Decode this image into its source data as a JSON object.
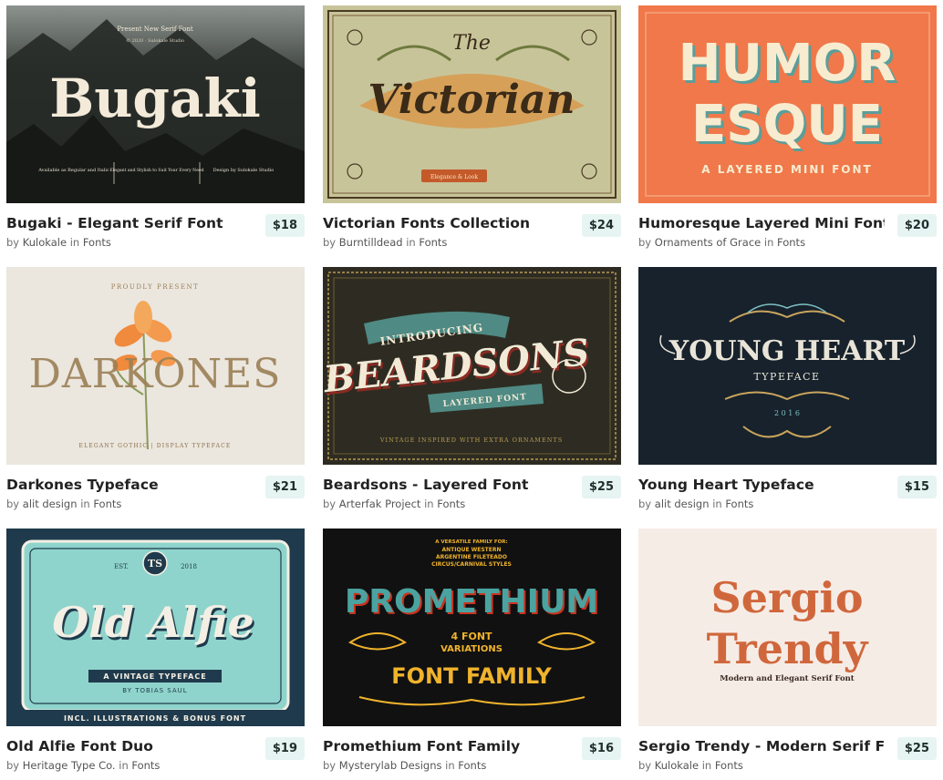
{
  "items": [
    {
      "title": "Bugaki - Elegant Serif Font",
      "price": "$18",
      "by": "by",
      "author": "Kulokale",
      "in": "in",
      "category": "Fonts",
      "thumb": {
        "headline": "Bugaki",
        "top_line": "Present New Serif Font",
        "sub_line": "© 2020 · Sulokale Studio",
        "foot_left": "Available as Regular and Italic",
        "foot_mid": "Elegant and Stylish to Suit Your Every Need",
        "foot_right": "Design by Sulokale Studio",
        "bg": "#2b2e2c",
        "fg": "#f3ead9"
      }
    },
    {
      "title": "Victorian Fonts Collection",
      "price": "$24",
      "by": "by",
      "author": "Burntilldead",
      "in": "in",
      "category": "Fonts",
      "thumb": {
        "headline": "Victorian",
        "top_line": "The",
        "badge": "Elegance & Look",
        "bg": "#c8c49a",
        "fg": "#3a2a18",
        "accent": "#c45a2a"
      }
    },
    {
      "title": "Humoresque Layered Mini Font",
      "price": "$20",
      "by": "by",
      "author": "Ornaments of Grace",
      "in": "in",
      "category": "Fonts",
      "thumb": {
        "line1": "HUMOR",
        "line2": "ESQUE",
        "sub": "A LAYERED MINI FONT",
        "bg": "#f0784a",
        "fg": "#f7ecd0",
        "shadow": "#5b9e9a"
      }
    },
    {
      "title": "Darkones Typeface",
      "price": "$21",
      "by": "by",
      "author": "alit design",
      "in": "in",
      "category": "Fonts",
      "thumb": {
        "headline": "DARKONES",
        "top_line": "PROUDLY PRESENT",
        "foot": "ELEGANT GOTHIC | DISPLAY TYPEFACE",
        "bg": "#ebe6de",
        "fg": "#9b8055",
        "flower": "#f08a3c"
      }
    },
    {
      "title": "Beardsons - Layered Font",
      "price": "$25",
      "by": "by",
      "author": "Arterfak Project",
      "in": "in",
      "category": "Fonts",
      "thumb": {
        "headline": "BEARDSONS",
        "top_line": "INTRODUCING",
        "sub": "LAYERED FONT",
        "foot": "VINTAGE INSPIRED WITH EXTRA ORNAMENTS",
        "bg": "#2e2c22",
        "fg": "#f2ead6",
        "accent": "#b89a52"
      }
    },
    {
      "title": "Young Heart Typeface",
      "price": "$15",
      "by": "by",
      "author": "alit design",
      "in": "in",
      "category": "Fonts",
      "thumb": {
        "headline": "YOUNG HEART",
        "sub": "TYPEFACE",
        "year": "2 0 1 6",
        "bg": "#17222c",
        "fg": "#e9e4d8",
        "accent": "#c9a45c"
      }
    },
    {
      "title": "Old Alfie Font Duo",
      "price": "$19",
      "by": "by",
      "author": "Heritage Type Co.",
      "in": "in",
      "category": "Fonts",
      "thumb": {
        "headline": "Old Alfie",
        "ribbon": "A VINTAGE TYPEFACE",
        "byline": "BY TOBIAS SAUL",
        "foot": "INCL. ILLUSTRATIONS & BONUS FONT",
        "est": "EST.",
        "year": "2018",
        "bg": "#1f3a4c",
        "panel": "#8fd4cc",
        "fg": "#f4efe4"
      }
    },
    {
      "title": "Promethium Font Family",
      "price": "$16",
      "by": "by",
      "author": "Mysterylab Designs",
      "in": "in",
      "category": "Fonts",
      "thumb": {
        "headline": "PROMETHIUM",
        "top1": "A VERSATILE FAMILY FOR:",
        "top2": "ANTIQUE WESTERN",
        "top3": "ARGENTINE FILETEADO",
        "top4": "CIRCUS/CARNIVAL STYLES",
        "mid1": "4 FONT",
        "mid2": "VARIATIONS",
        "foot": "FONT FAMILY",
        "bg": "#111111",
        "fg": "#f0b32c",
        "red": "#c8331f",
        "teal": "#4aa3a0"
      }
    },
    {
      "title": "Sergio Trendy - Modern Serif Font",
      "price": "$25",
      "by": "by",
      "author": "Kulokale",
      "in": "in",
      "category": "Fonts",
      "thumb": {
        "line1": "Sergio",
        "line2": "Trendy",
        "sub": "Modern and Elegant Serif Font",
        "bg": "#f6ece6",
        "fg": "#d0673c"
      }
    }
  ]
}
